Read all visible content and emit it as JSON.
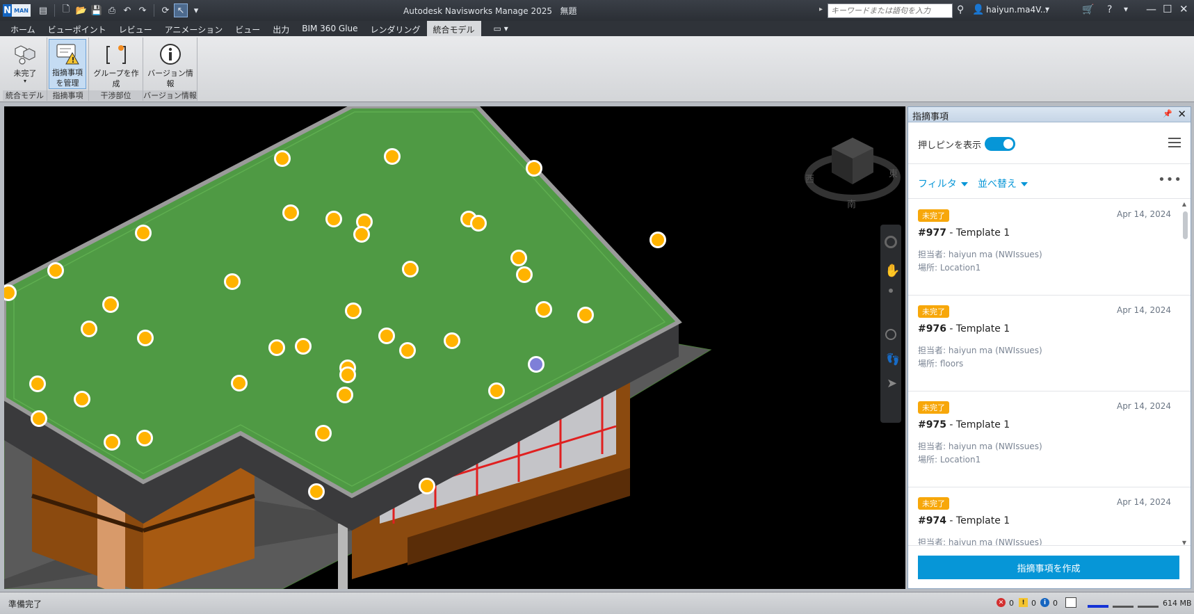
{
  "window": {
    "app_title": "Autodesk Navisworks Manage 2025",
    "doc_title": "無題",
    "search_placeholder": "キーワードまたは語句を入力",
    "user": "haiyun.ma4V...",
    "logo_letter": "N",
    "logo_sub": "MAN"
  },
  "tabs": [
    "ホーム",
    "ビューポイント",
    "レビュー",
    "アニメーション",
    "ビュー",
    "出力",
    "BIM 360 Glue",
    "レンダリング",
    "統合モデル"
  ],
  "active_tab_index": 8,
  "ribbon": {
    "groups": [
      {
        "label": "統合モデル",
        "buttons": [
          {
            "label": "未完了",
            "has_dropdown": true
          }
        ]
      },
      {
        "label": "指摘事項",
        "buttons": [
          {
            "label_line1": "指摘事項",
            "label_line2": "を管理",
            "active": true
          }
        ]
      },
      {
        "label": "干渉部位",
        "buttons": [
          {
            "label": "グループを作成"
          }
        ]
      },
      {
        "label": "バージョン情報",
        "buttons": [
          {
            "label": "バージョン情報"
          }
        ]
      }
    ]
  },
  "viewcube": {
    "west": "西",
    "east": "東",
    "south": "南"
  },
  "issues_panel": {
    "title": "指摘事項",
    "show_pins_label": "押しピンを表示",
    "show_pins": true,
    "filter_label": "フィルタ",
    "sort_label": "並べ替え",
    "create_button": "指摘事項を作成",
    "issues": [
      {
        "status": "未完了",
        "date": "Apr 14, 2024",
        "number": "#977",
        "title": "- Template 1",
        "assignee": "担当者: haiyun ma (NWIssues)",
        "location": "場所: Location1"
      },
      {
        "status": "未完了",
        "date": "Apr 14, 2024",
        "number": "#976",
        "title": "- Template 1",
        "assignee": "担当者: haiyun ma (NWIssues)",
        "location": "場所: floors"
      },
      {
        "status": "未完了",
        "date": "Apr 14, 2024",
        "number": "#975",
        "title": "- Template 1",
        "assignee": "担当者: haiyun ma (NWIssues)",
        "location": "場所: Location1"
      },
      {
        "status": "未完了",
        "date": "Apr 14, 2024",
        "number": "#974",
        "title": "- Template 1",
        "assignee": "担当者: haiyun ma (NWIssues)",
        "location": ""
      }
    ]
  },
  "status": {
    "text": "準備完了",
    "errors": "0",
    "warnings": "0",
    "infos": "0",
    "memory": "614 MB"
  },
  "colors": {
    "accent": "#0696d7",
    "badge_open": "#f7a70a",
    "pin": "#ffb300",
    "pin_selected": "#7e7fd8",
    "roof": "#4f9a44"
  }
}
